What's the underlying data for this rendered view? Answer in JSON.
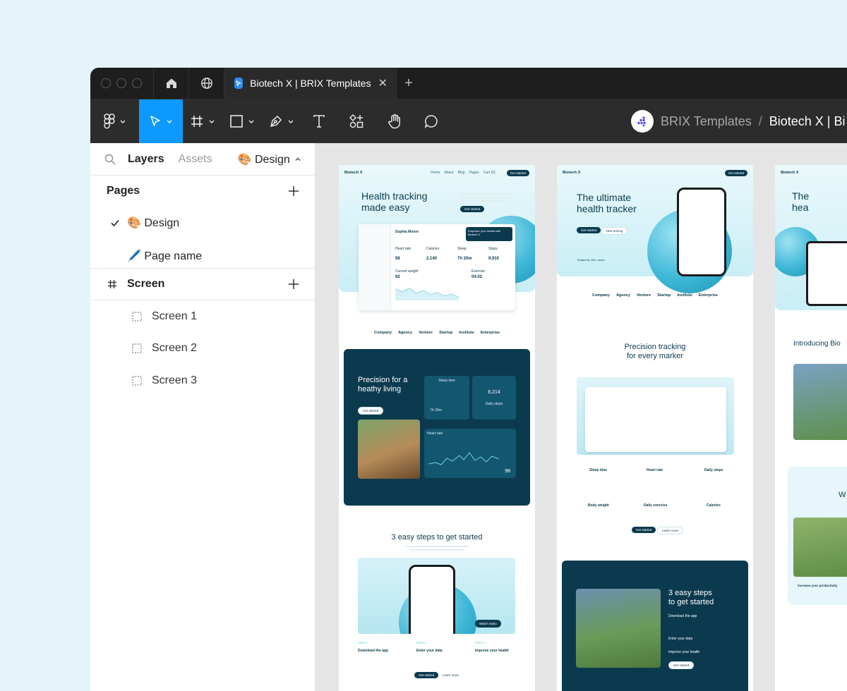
{
  "tabbar": {
    "tab_title": "Biotech X | BRIX Templates",
    "close_glyph": "✕",
    "new_tab_glyph": "+"
  },
  "toolbar": {
    "team_name": "BRIX Templates",
    "separator": "/",
    "file_name": "Biotech X | Bi"
  },
  "panel": {
    "tabs": {
      "layers": "Layers",
      "assets": "Assets",
      "design": "🎨 Design"
    },
    "pages_title": "Pages",
    "pages": [
      {
        "label": "🎨 Design",
        "checked": true
      },
      {
        "label": "🖊️ Page name",
        "checked": false
      }
    ],
    "screen_section": "Screen",
    "screens": [
      "Screen 1",
      "Screen 2",
      "Screen 3"
    ]
  },
  "canvas": {
    "frame1": {
      "brand": "Biotech X",
      "nav_links": [
        "Home",
        "About",
        "Blog",
        "Pages",
        "Cart (0)"
      ],
      "nav_cta": "Get started",
      "hero_title_1": "Health tracking",
      "hero_title_2": "made easy",
      "hero_cta": "Get started",
      "dash_user": "Sophia Moore",
      "dash_promo": "Empower your health with Biotech X",
      "stats": [
        "Heart rate",
        "Calories",
        "Sleep",
        "Steps"
      ],
      "stat_values": [
        "98",
        "2,140",
        "7h 20m",
        "9,910"
      ],
      "weight_label": "Current weight",
      "weight_value": "82",
      "exercise_label": "Exercise",
      "exercise_value": "04.02",
      "logos": [
        "Company",
        "Agency",
        "Venture",
        "Startup",
        "Institute",
        "Enterprise"
      ],
      "precision_title_1": "Precision for a",
      "precision_title_2": "heathy living",
      "precision_cta": "Get started",
      "sleep_tile": "Sleep time",
      "sleep_value": "7h 20m",
      "steps_value": "8,214",
      "steps_tile": "Daily steps",
      "heart_tile": "Heart rate",
      "heart_value": "98",
      "steps_title": "3 easy steps to get started",
      "watch_video": "Watch video",
      "step_labels": [
        "STEP 1",
        "STEP 2",
        "STEP 3"
      ],
      "step_titles": [
        "Download the app",
        "Enter your data",
        "Improve your health"
      ],
      "get_started": "Get started",
      "learn_more": "Learn more"
    },
    "frame2": {
      "brand": "Biotech X",
      "nav_cta": "Get started",
      "hero_title_1": "The ultimate",
      "hero_title_2": "health tracker",
      "cta_primary": "Get started",
      "cta_secondary": "View pricing",
      "trust": "Trusted by 10k+ users",
      "logos": [
        "Company",
        "Agency",
        "Venture",
        "Startup",
        "Institute",
        "Enterprise"
      ],
      "precision_1": "Precision tracking",
      "precision_2": "for every marker",
      "features": [
        "Sleep time",
        "Heart rate",
        "Daily steps",
        "Body weight",
        "Daily exercise",
        "Calories"
      ],
      "cta_primary_2": "Get started",
      "cta_secondary_2": "Learn more",
      "steps_title_1": "3 easy steps",
      "steps_title_2": "to get started",
      "steps": [
        "Download the app",
        "Enter your data",
        "Improve your health"
      ],
      "steps_cta": "Get started"
    },
    "frame3": {
      "brand": "Biotech X",
      "hero_title_1": "The",
      "hero_title_2": "hea",
      "intro": "Introducing Bio",
      "w_title": "W",
      "productivity": "Increase your productivity"
    }
  },
  "colors": {
    "accent": "#0d99ff",
    "brand_dark": "#0b3a4e",
    "brand_sphere": "#3fb7d6"
  }
}
